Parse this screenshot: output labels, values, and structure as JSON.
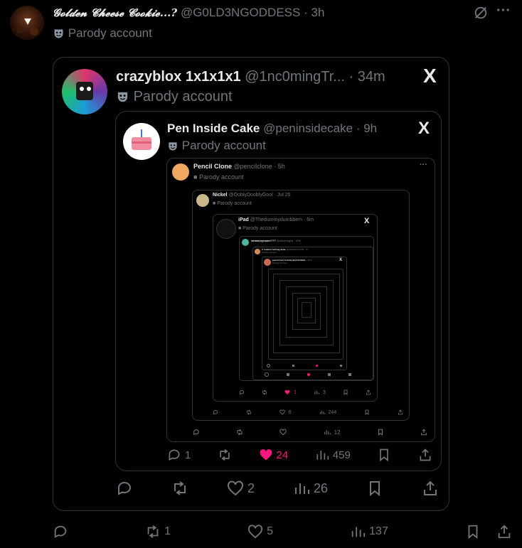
{
  "outer": {
    "display_name": "𝓖𝓸𝓵𝓭𝓮𝓷 𝓒𝓱𝓮𝓮𝓼𝓮 𝓒𝓸𝓸𝓴𝓲𝓮...?",
    "handle": "@G0LD3NGODDESS",
    "time": "3h",
    "badge": "Parody account",
    "more": "···",
    "replies": "",
    "retweets": "1",
    "likes": "5",
    "views": "137"
  },
  "q1": {
    "display_name": "crazyblox 1x1x1x1",
    "handle": "@1nc0mingTr...",
    "time": "34m",
    "badge": "Parody account",
    "x_logo": "X",
    "replies": "",
    "retweets": "",
    "likes": "2",
    "views": "26"
  },
  "q2": {
    "display_name": "Pen Inside Cake",
    "handle": "@peninsidecake",
    "time": "9h",
    "badge": "Parody account",
    "x_logo": "X",
    "replies": "1",
    "retweets": "",
    "likes": "24",
    "views": "459"
  },
  "q3": {
    "display_name": "Pencil Clone",
    "handle": "@pencilclone",
    "time": "5h",
    "badge": "Parody account",
    "more": "···",
    "views": "12"
  },
  "q4": {
    "display_name": "Nickel",
    "handle": "@OoblyDooblyGool",
    "time": "Jul 25",
    "badge": "Parody account",
    "likes": "6",
    "views": "244"
  },
  "q5": {
    "display_name": "iPad",
    "handle": "@Thedummydumbbem",
    "time": "6m",
    "badge": "Parody account",
    "x_logo": "X",
    "likes": "1",
    "views": "3"
  },
  "q6": {
    "display_name": "whatsmyname???",
    "handle": "@idkdmughs · 40s"
  },
  "q7": {
    "display_name": "A random fucking dude",
    "handle": "@ahh8ISAGATOR · 7h",
    "badge": "Parody account"
  },
  "q8": {
    "display_name": "pencil from fortnite (R-R-R-RIGH...",
    "handle": "18m",
    "badge": "Parody account",
    "x_logo": "X"
  },
  "colors": {
    "like_pink": "#f91880",
    "muted": "#71767b",
    "border": "#2f3336",
    "text": "#e7e9ea"
  }
}
